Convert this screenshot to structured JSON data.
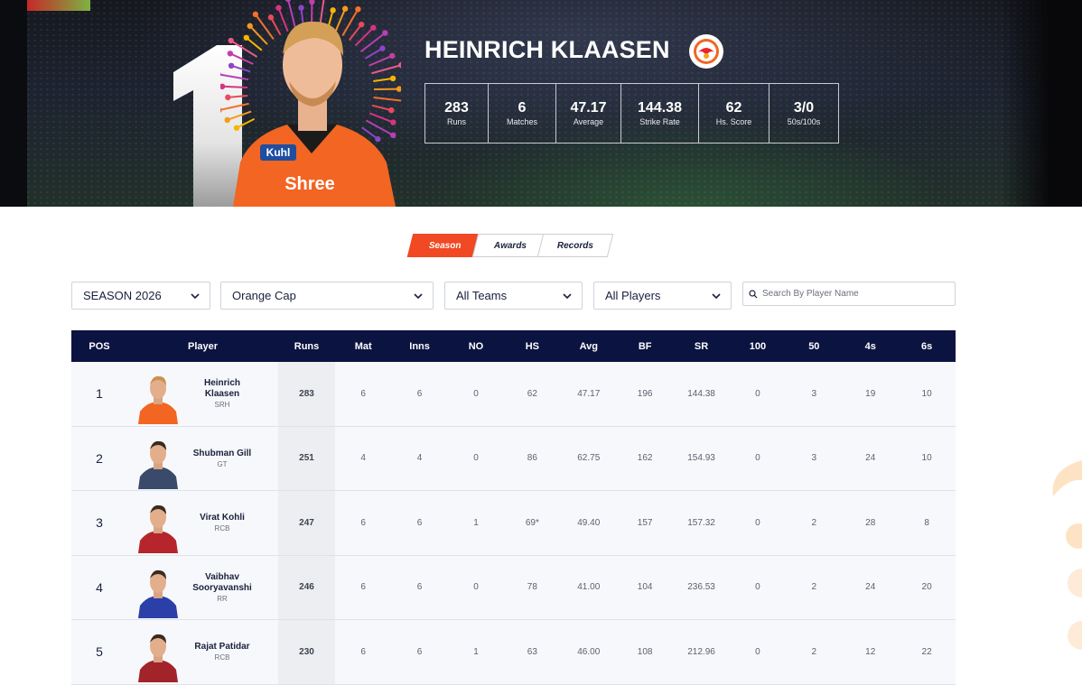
{
  "hero": {
    "rank": "1",
    "player_name": "HEINRICH KLAASEN",
    "team_logo_icon": "sunrisers-hyderabad-logo-icon",
    "stats": [
      {
        "value": "283",
        "label": "Runs"
      },
      {
        "value": "6",
        "label": "Matches"
      },
      {
        "value": "47.17",
        "label": "Average"
      },
      {
        "value": "144.38",
        "label": "Strike Rate"
      },
      {
        "value": "62",
        "label": "Hs. Score"
      },
      {
        "value": "3/0",
        "label": "50s/100s"
      }
    ]
  },
  "tabs": [
    {
      "label": "Season",
      "active": true
    },
    {
      "label": "Awards",
      "active": false
    },
    {
      "label": "Records",
      "active": false
    }
  ],
  "filters": {
    "season": "SEASON 2026",
    "cap": "Orange Cap",
    "teams": "All Teams",
    "players": "All Players",
    "search_placeholder": "Search By Player Name"
  },
  "table": {
    "headers": [
      "POS",
      "Player",
      "Runs",
      "Mat",
      "Inns",
      "NO",
      "HS",
      "Avg",
      "BF",
      "SR",
      "100",
      "50",
      "4s",
      "6s"
    ],
    "rows": [
      {
        "pos": "1",
        "name": "Heinrich Klaasen",
        "team": "SRH",
        "runs": "283",
        "mat": "6",
        "inns": "6",
        "no": "0",
        "hs": "62",
        "avg": "47.17",
        "bf": "196",
        "sr": "144.38",
        "h100": "0",
        "h50": "3",
        "fours": "19",
        "sixes": "10",
        "jersey": "#f26522"
      },
      {
        "pos": "2",
        "name": "Shubman Gill",
        "team": "GT",
        "runs": "251",
        "mat": "4",
        "inns": "4",
        "no": "0",
        "hs": "86",
        "avg": "62.75",
        "bf": "162",
        "sr": "154.93",
        "h100": "0",
        "h50": "3",
        "fours": "24",
        "sixes": "10",
        "jersey": "#3a4a6b"
      },
      {
        "pos": "3",
        "name": "Virat Kohli",
        "team": "RCB",
        "runs": "247",
        "mat": "6",
        "inns": "6",
        "no": "1",
        "hs": "69*",
        "avg": "49.40",
        "bf": "157",
        "sr": "157.32",
        "h100": "0",
        "h50": "2",
        "fours": "28",
        "sixes": "8",
        "jersey": "#b5252b"
      },
      {
        "pos": "4",
        "name": "Vaibhav Sooryavanshi",
        "team": "RR",
        "runs": "246",
        "mat": "6",
        "inns": "6",
        "no": "0",
        "hs": "78",
        "avg": "41.00",
        "bf": "104",
        "sr": "236.53",
        "h100": "0",
        "h50": "2",
        "fours": "24",
        "sixes": "20",
        "jersey": "#2a3fa8"
      },
      {
        "pos": "5",
        "name": "Rajat Patidar",
        "team": "RCB",
        "runs": "230",
        "mat": "6",
        "inns": "6",
        "no": "1",
        "hs": "63",
        "avg": "46.00",
        "bf": "108",
        "sr": "212.96",
        "h100": "0",
        "h50": "2",
        "fours": "12",
        "sixes": "22",
        "jersey": "#a3232b"
      }
    ]
  },
  "colors": {
    "accent": "#f04923",
    "table_header": "#0b1340",
    "runs_column": "#eceef1"
  }
}
